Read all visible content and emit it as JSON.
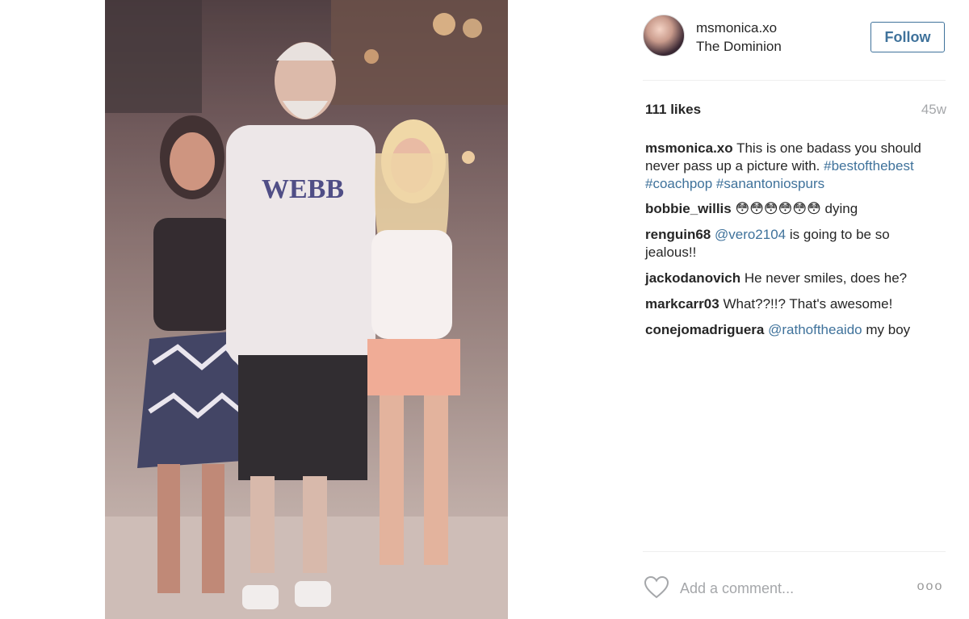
{
  "post": {
    "photo_people": "three",
    "shirt_text": "WEBB"
  },
  "header": {
    "username": "msmonica.xo",
    "location": "The Dominion",
    "follow_label": "Follow"
  },
  "stats": {
    "likes": "111 likes",
    "age": "45w"
  },
  "caption": {
    "author": "msmonica.xo",
    "text": "This is one badass you should never pass up a picture with.",
    "tags": [
      "#bestofthebest",
      "#coachpop",
      "#sanantoniospurs"
    ]
  },
  "comments": [
    {
      "author": "bobbie_willis",
      "pre": "",
      "mention": "",
      "text": "😳😳😳😳😳😳 dying"
    },
    {
      "author": "renguin68",
      "pre": "",
      "mention": "@vero2104",
      "text": "is going to be so jealous!!"
    },
    {
      "author": "jackodanovich",
      "pre": "",
      "mention": "",
      "text": "He never smiles, does he?"
    },
    {
      "author": "markcarr03",
      "pre": "",
      "mention": "",
      "text": "What??!!? That's awesome!"
    },
    {
      "author": "conejomadriguera",
      "pre": "",
      "mention": "@rathoftheaido",
      "text": "my boy"
    }
  ],
  "footer": {
    "comment_placeholder": "Add a comment...",
    "more_label": "ooo",
    "like_icon": "heart-outline-icon"
  },
  "colors": {
    "link": "#3f729b",
    "muted": "#a5a7aa",
    "text": "#262626"
  }
}
